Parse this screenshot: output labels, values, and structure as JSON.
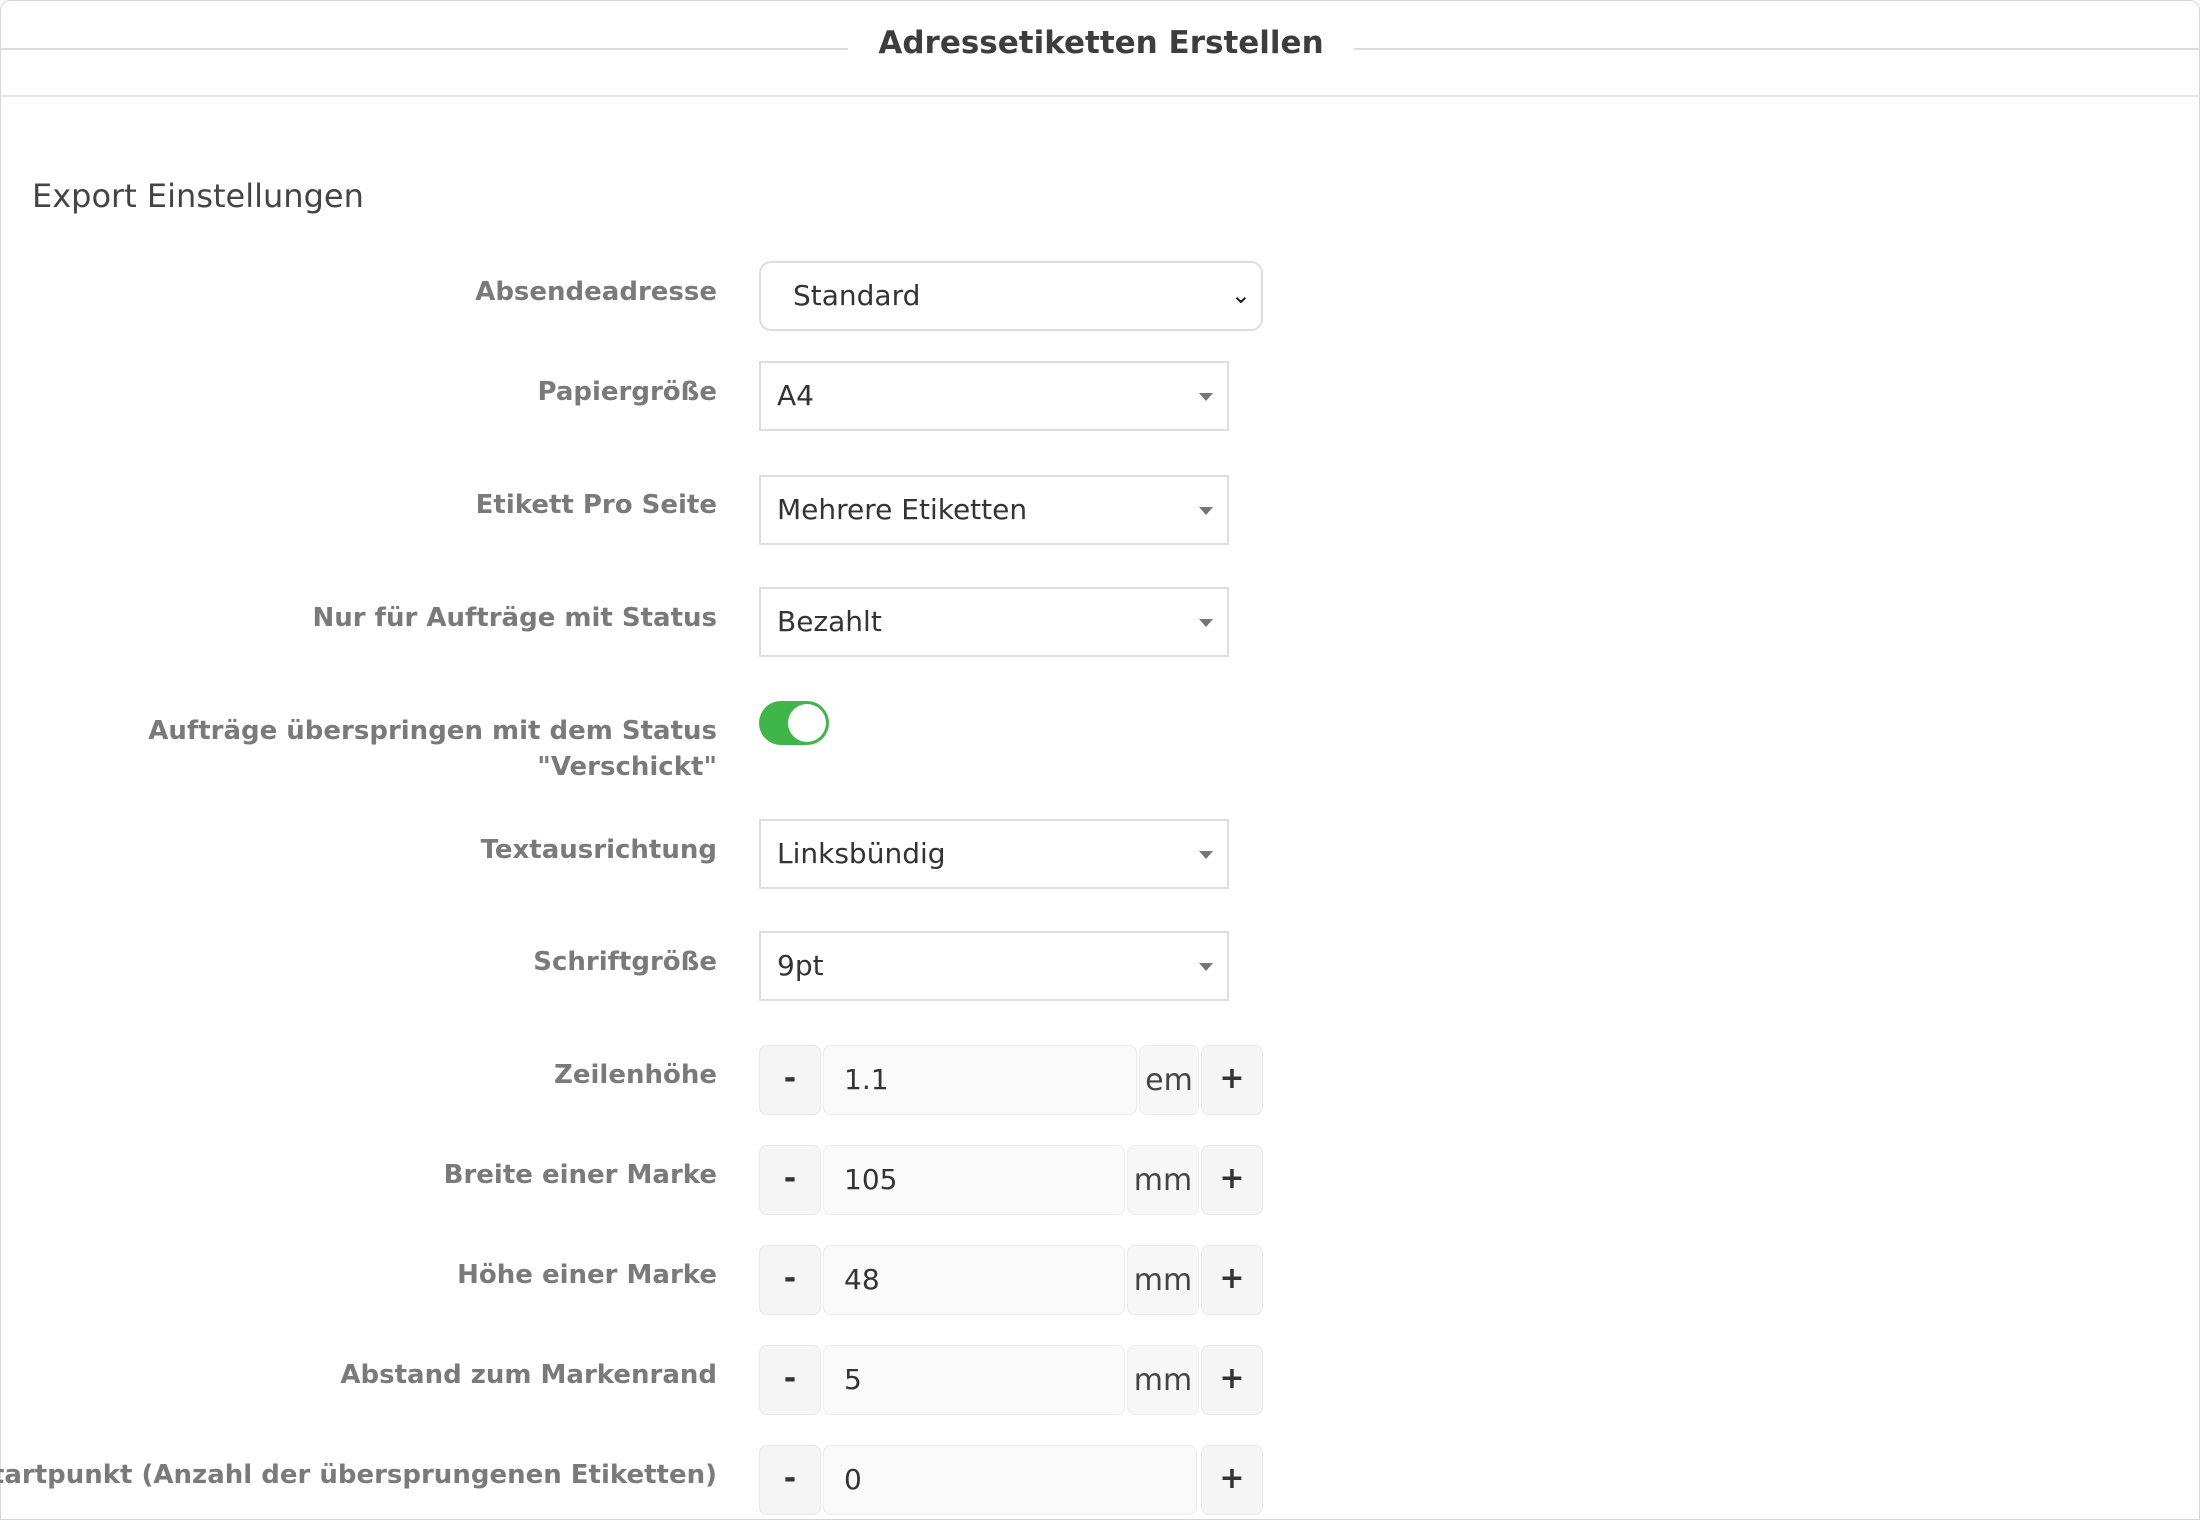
{
  "title": "Adressetiketten Erstellen",
  "section_title": "Export Einstellungen",
  "fields": {
    "sender": {
      "label": "Absendeadresse",
      "value": "Standard"
    },
    "paper": {
      "label": "Papiergröße",
      "value": "A4"
    },
    "per_page": {
      "label": "Etikett Pro Seite",
      "value": "Mehrere Etiketten"
    },
    "status": {
      "label": "Nur für Aufträge mit Status",
      "value": "Bezahlt"
    },
    "skip_shipped": {
      "label_line1": "Aufträge überspringen mit dem Status",
      "label_line2": "\"Verschickt\"",
      "enabled": true
    },
    "alignment": {
      "label": "Textausrichtung",
      "value": "Linksbündig"
    },
    "font_size": {
      "label": "Schriftgröße",
      "value": "9pt"
    },
    "line_height": {
      "label": "Zeilenhöhe",
      "value": "1.1",
      "unit": "em"
    },
    "label_width": {
      "label": "Breite einer Marke",
      "value": "105",
      "unit": "mm"
    },
    "label_height": {
      "label": "Höhe einer Marke",
      "value": "48",
      "unit": "mm"
    },
    "margin": {
      "label": "Abstand zum Markenrand",
      "value": "5",
      "unit": "mm"
    },
    "start": {
      "label": "Startpunkt (Anzahl der übersprungenen Etiketten)",
      "value": "0"
    }
  },
  "stepper_buttons": {
    "minus": "-",
    "plus": "+"
  },
  "colors": {
    "toggle_on": "#3fb54a"
  }
}
